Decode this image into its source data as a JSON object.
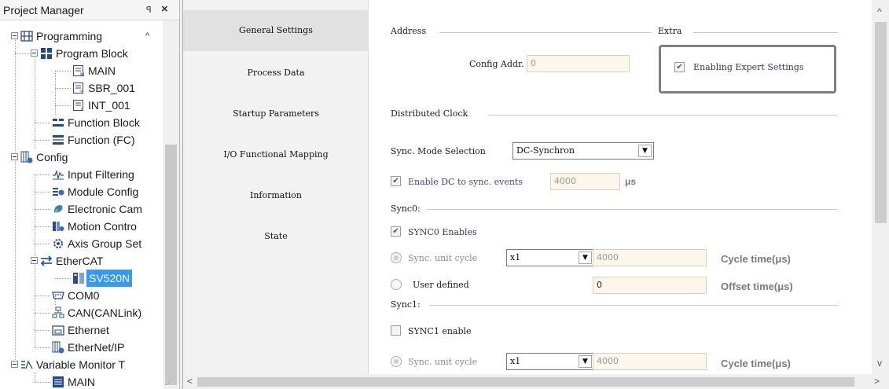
{
  "project_manager": {
    "title": "Project Manager",
    "pin": "ꟼ",
    "close": "×",
    "tree": [
      {
        "label": "Programming",
        "icon": "ladder-icon"
      },
      {
        "label": "Program Block",
        "icon": "program-block-icon"
      },
      {
        "label": "MAIN",
        "icon": "main-program-icon"
      },
      {
        "label": "SBR_001",
        "icon": "subroutine-icon"
      },
      {
        "label": "INT_001",
        "icon": "interrupt-icon"
      },
      {
        "label": "Function Block",
        "icon": "function-block-icon"
      },
      {
        "label": "Function (FC)",
        "icon": "function-icon"
      },
      {
        "label": "Config",
        "icon": "config-icon"
      },
      {
        "label": "Input Filtering",
        "icon": "input-filter-icon"
      },
      {
        "label": "Module Config",
        "icon": "module-config-icon"
      },
      {
        "label": "Electronic Cam",
        "icon": "cam-icon"
      },
      {
        "label": "Motion Contro",
        "icon": "motion-control-icon"
      },
      {
        "label": "Axis Group Set",
        "icon": "axis-group-icon"
      },
      {
        "label": "EtherCAT",
        "icon": "ethercat-icon"
      },
      {
        "label": "SV520N",
        "icon": "device-icon"
      },
      {
        "label": "COM0",
        "icon": "serial-port-icon"
      },
      {
        "label": "CAN(CANLink)",
        "icon": "can-icon"
      },
      {
        "label": "Ethernet",
        "icon": "ethernet-icon"
      },
      {
        "label": "EtherNet/IP",
        "icon": "ethernet-ip-icon"
      },
      {
        "label": "Variable Monitor T",
        "icon": "variable-monitor-icon"
      },
      {
        "label": "MAIN",
        "icon": "monitor-table-icon"
      }
    ]
  },
  "nav": {
    "items": [
      "General Settings",
      "Process Data",
      "Startup Parameters",
      "I/O Functional Mapping",
      "Information",
      "State"
    ],
    "active_index": 0
  },
  "address": {
    "section_title": "Address",
    "config_addr_label": "Config Addr.",
    "config_addr_value": "0"
  },
  "extra": {
    "section_title": "Extra",
    "expert_label": "Enabling Expert Settings",
    "expert_checked": true
  },
  "dc": {
    "section_title": "Distributed Clock",
    "sync_mode_label": "Sync. Mode Selection",
    "sync_mode_value": "DC-Synchron",
    "enable_dc_label": "Enable DC to sync. events",
    "enable_dc_value": "4000",
    "enable_dc_unit": "μs"
  },
  "sync0": {
    "title": "Sync0:",
    "enable_label": "SYNC0 Enables",
    "unit_cycle_label": "Sync. unit cycle",
    "multiplier": "x1",
    "cycle_value": "4000",
    "cycle_time_label": "Cycle time(μs)",
    "user_defined_label": "User defined",
    "offset_value": "0",
    "offset_time_label": "Offset time(μs)"
  },
  "sync1": {
    "title": "Sync1:",
    "enable_label": "SYNC1 enable",
    "unit_cycle_label": "Sync. unit cycle",
    "multiplier": "x1",
    "cycle_value": "4000",
    "cycle_time_label": "Cycle time(μs)"
  },
  "glyphs": {
    "check": "✔",
    "dropdown": "▼",
    "up": "^",
    "down": "v",
    "left": "<",
    "right": ">"
  }
}
